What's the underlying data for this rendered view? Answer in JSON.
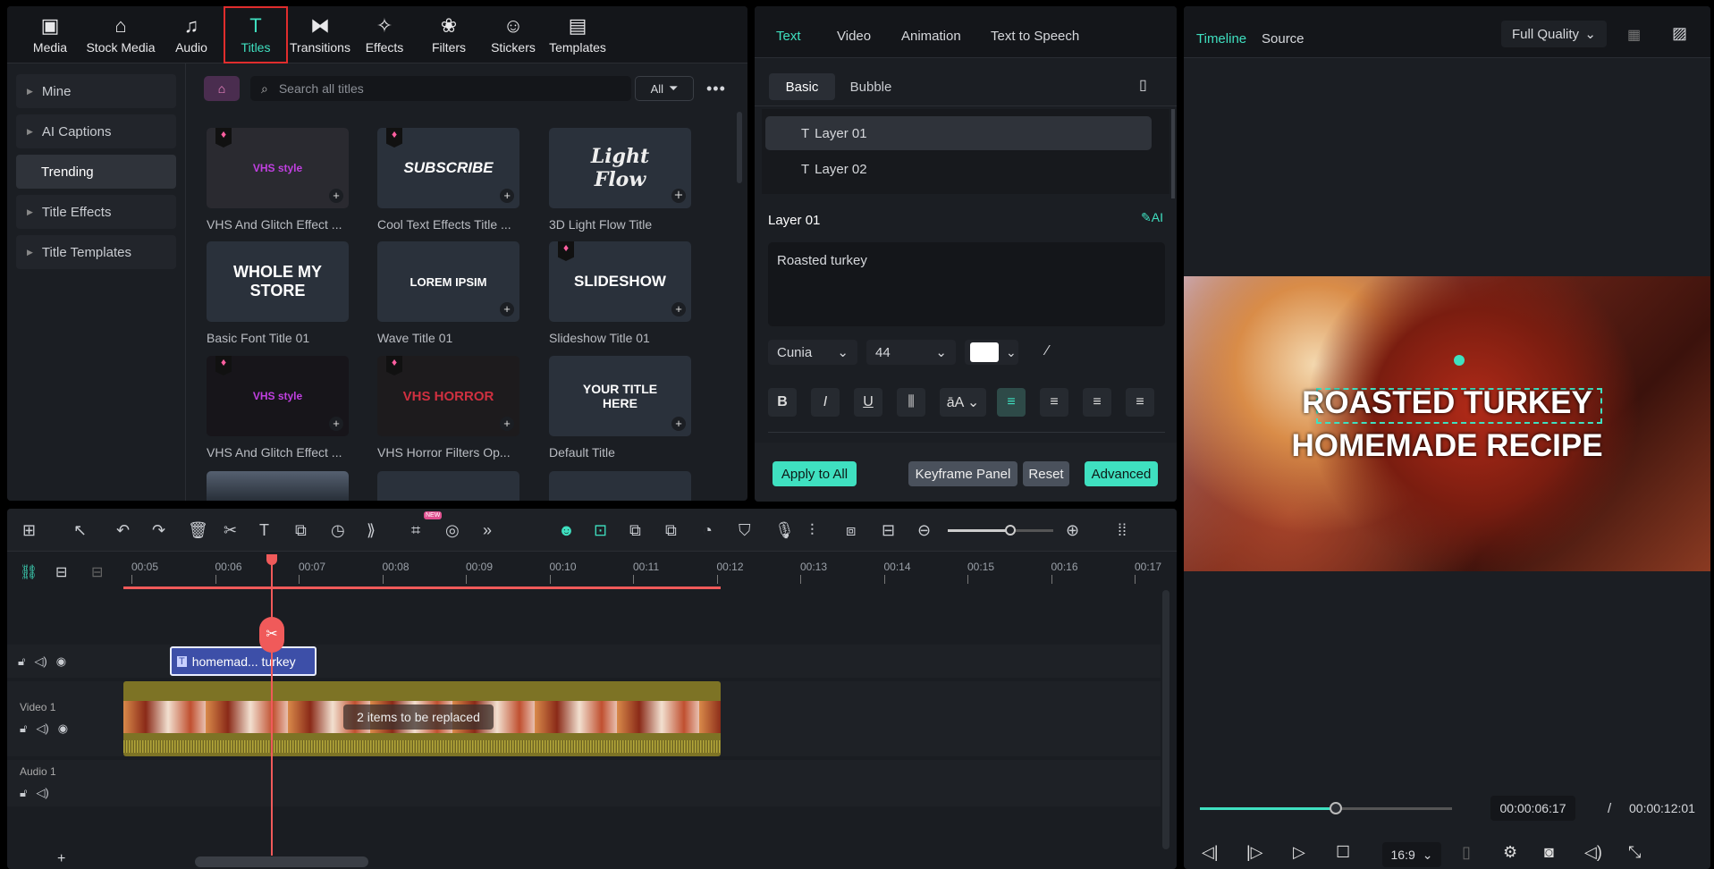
{
  "nav": [
    {
      "label": "Media",
      "icon": "media-icon",
      "glyph": "▣"
    },
    {
      "label": "Stock Media",
      "icon": "store-icon",
      "glyph": "⌂"
    },
    {
      "label": "Audio",
      "icon": "music-note-icon",
      "glyph": "♫"
    },
    {
      "label": "Titles",
      "icon": "text-t-icon",
      "glyph": "T"
    },
    {
      "label": "Transitions",
      "icon": "transition-icon",
      "glyph": "⧓"
    },
    {
      "label": "Effects",
      "icon": "star-icon",
      "glyph": "✧"
    },
    {
      "label": "Filters",
      "icon": "filter-icon",
      "glyph": "❀"
    },
    {
      "label": "Stickers",
      "icon": "sticker-icon",
      "glyph": "☺"
    },
    {
      "label": "Templates",
      "icon": "template-icon",
      "glyph": "▤"
    }
  ],
  "sidebar": [
    {
      "label": "Mine"
    },
    {
      "label": "AI Captions"
    },
    {
      "label": "Trending"
    },
    {
      "label": "Title Effects"
    },
    {
      "label": "Title Templates"
    }
  ],
  "search": {
    "placeholder": "Search all titles",
    "filter": "All"
  },
  "titles": [
    {
      "label": "VHS And Glitch Effect ...",
      "preview": "VHS style",
      "premium": true
    },
    {
      "label": "Cool Text Effects Title ...",
      "preview": "SUBSCRIBE",
      "premium": true
    },
    {
      "label": "3D Light Flow Title",
      "preview": "Light Flow",
      "premium": false
    },
    {
      "label": "Basic Font Title 01",
      "preview": "WHOLE MY STORE",
      "premium": false
    },
    {
      "label": "Wave Title 01",
      "preview": "LOREM IPSIM",
      "premium": false
    },
    {
      "label": "Slideshow Title 01",
      "preview": "SLIDESHOW",
      "premium": true
    },
    {
      "label": "VHS And Glitch Effect ...",
      "preview": "VHS style",
      "premium": true
    },
    {
      "label": "VHS Horror Filters Op...",
      "preview": "VHS HORROR",
      "premium": true
    },
    {
      "label": "Default Title",
      "preview": "YOUR TITLE HERE",
      "premium": false
    }
  ],
  "props": {
    "tabs": [
      "Text",
      "Video",
      "Animation",
      "Text to Speech"
    ],
    "subtabs": [
      "Basic",
      "Bubble"
    ],
    "layers": [
      "Layer 01",
      "Layer 02"
    ],
    "layer_heading": "Layer 01",
    "text_value": "Roasted turkey",
    "font": "Cunia",
    "size": "44",
    "color": "#ffffff",
    "buttons": {
      "apply": "Apply to All",
      "keyframe": "Keyframe Panel",
      "reset": "Reset",
      "advanced": "Advanced"
    }
  },
  "preview": {
    "tabs": [
      "Timeline",
      "Source"
    ],
    "quality": "Full Quality",
    "line1": "ROASTED TURKEY",
    "line2": "HOMEMADE RECIPE",
    "current": "00:00:06:17",
    "sep": "/",
    "total": "00:00:12:01",
    "progress": 0.54,
    "ratio": "16:9"
  },
  "timeline": {
    "ticks": [
      "00:05",
      "00:06",
      "00:07",
      "00:08",
      "00:09",
      "00:10",
      "00:11",
      "00:12",
      "00:13",
      "00:14",
      "00:15",
      "00:16",
      "00:17"
    ],
    "title_clip": "homemad... turkey",
    "video_track": "Video 1",
    "audio_track": "Audio 1",
    "replace_note": "2 items to be replaced",
    "new_badge": "NEW"
  },
  "colors": {
    "accent": "#3fe0c0",
    "playhead": "#f05a5a",
    "title_clip": "#3d4fa8",
    "video_clip": "#7d7325"
  }
}
